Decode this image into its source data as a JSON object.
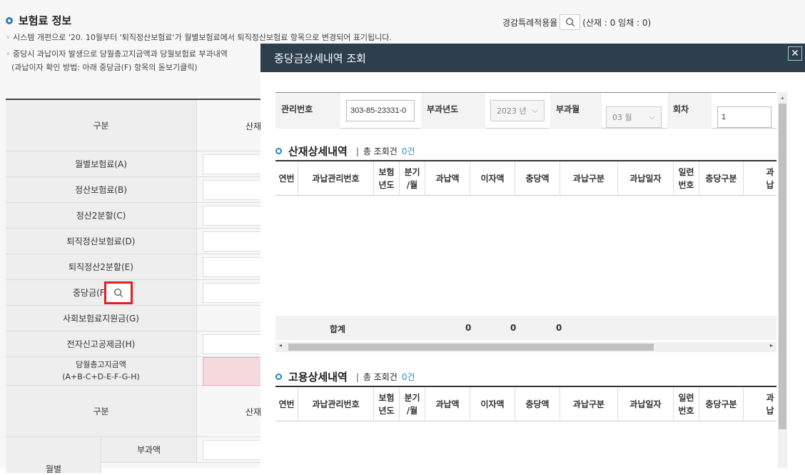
{
  "background": {
    "title": "보험료 정보",
    "notes": [
      "◦ 시스템 개편으로 '20. 10월부터 '퇴직정산보험료'가 월별보험료에서 퇴직정산보험료 항목으로 변경되어 표기됩니다.",
      "◦ 중당시 과납이자 발생으로 당월총고지금액과 당월보험료 부과내역",
      "(과납이자 확인 방법: 아래 중당금(F) 항목의 돋보기클릭)"
    ],
    "reduction_label": "경감특례적용율",
    "reduction_value": "(산재 : 0 임채 : 0)",
    "table_header_left": "구분",
    "table_header_right": "산재",
    "rows": [
      "월별보험료(A)",
      "정산보험료(B)",
      "정산2분할(C)",
      "퇴직정산보험료(D)",
      "퇴직정산2분할(E)",
      "중당금(F)",
      "사회보험료지원금(G)",
      "전자신고공제금(H)",
      "당월총고지금액\n(A+B-C+D-E-F-G-H)"
    ],
    "table2_header_left": "구분",
    "table2_header_right": "산재",
    "table2_sub1": "부과액",
    "table2_sub2": "월별"
  },
  "modal": {
    "title": "중당금상세내역 조회",
    "close_label": "✕",
    "search": {
      "mgmt_label": "관리번호",
      "mgmt_value": "303-85-23331-0",
      "year_label": "부과년도",
      "year_value": "2023 년",
      "month_label": "부과월",
      "month_value": "03 월",
      "round_label": "회차",
      "round_value": "1"
    },
    "sections": [
      {
        "title": "산재상세내역",
        "count_label": "총 조회건",
        "count": "0건",
        "columns": [
          "연번",
          "과납관리번호",
          "보험\n년도",
          "분기\n/월",
          "과납액",
          "이자액",
          "충당액",
          "과납구분",
          "과납일자",
          "일련\n번호",
          "충당구분",
          "과납"
        ],
        "sum_label": "합계",
        "sums": [
          "0",
          "0",
          "0"
        ]
      },
      {
        "title": "고용상세내역",
        "count_label": "총 조회건",
        "count": "0건",
        "columns": [
          "연번",
          "과납관리번호",
          "보험\n년도",
          "분기\n/월",
          "과납액",
          "이자액",
          "충당액",
          "과납구분",
          "과납일자",
          "일련\n번호",
          "충당구분",
          "과납"
        ]
      }
    ]
  }
}
